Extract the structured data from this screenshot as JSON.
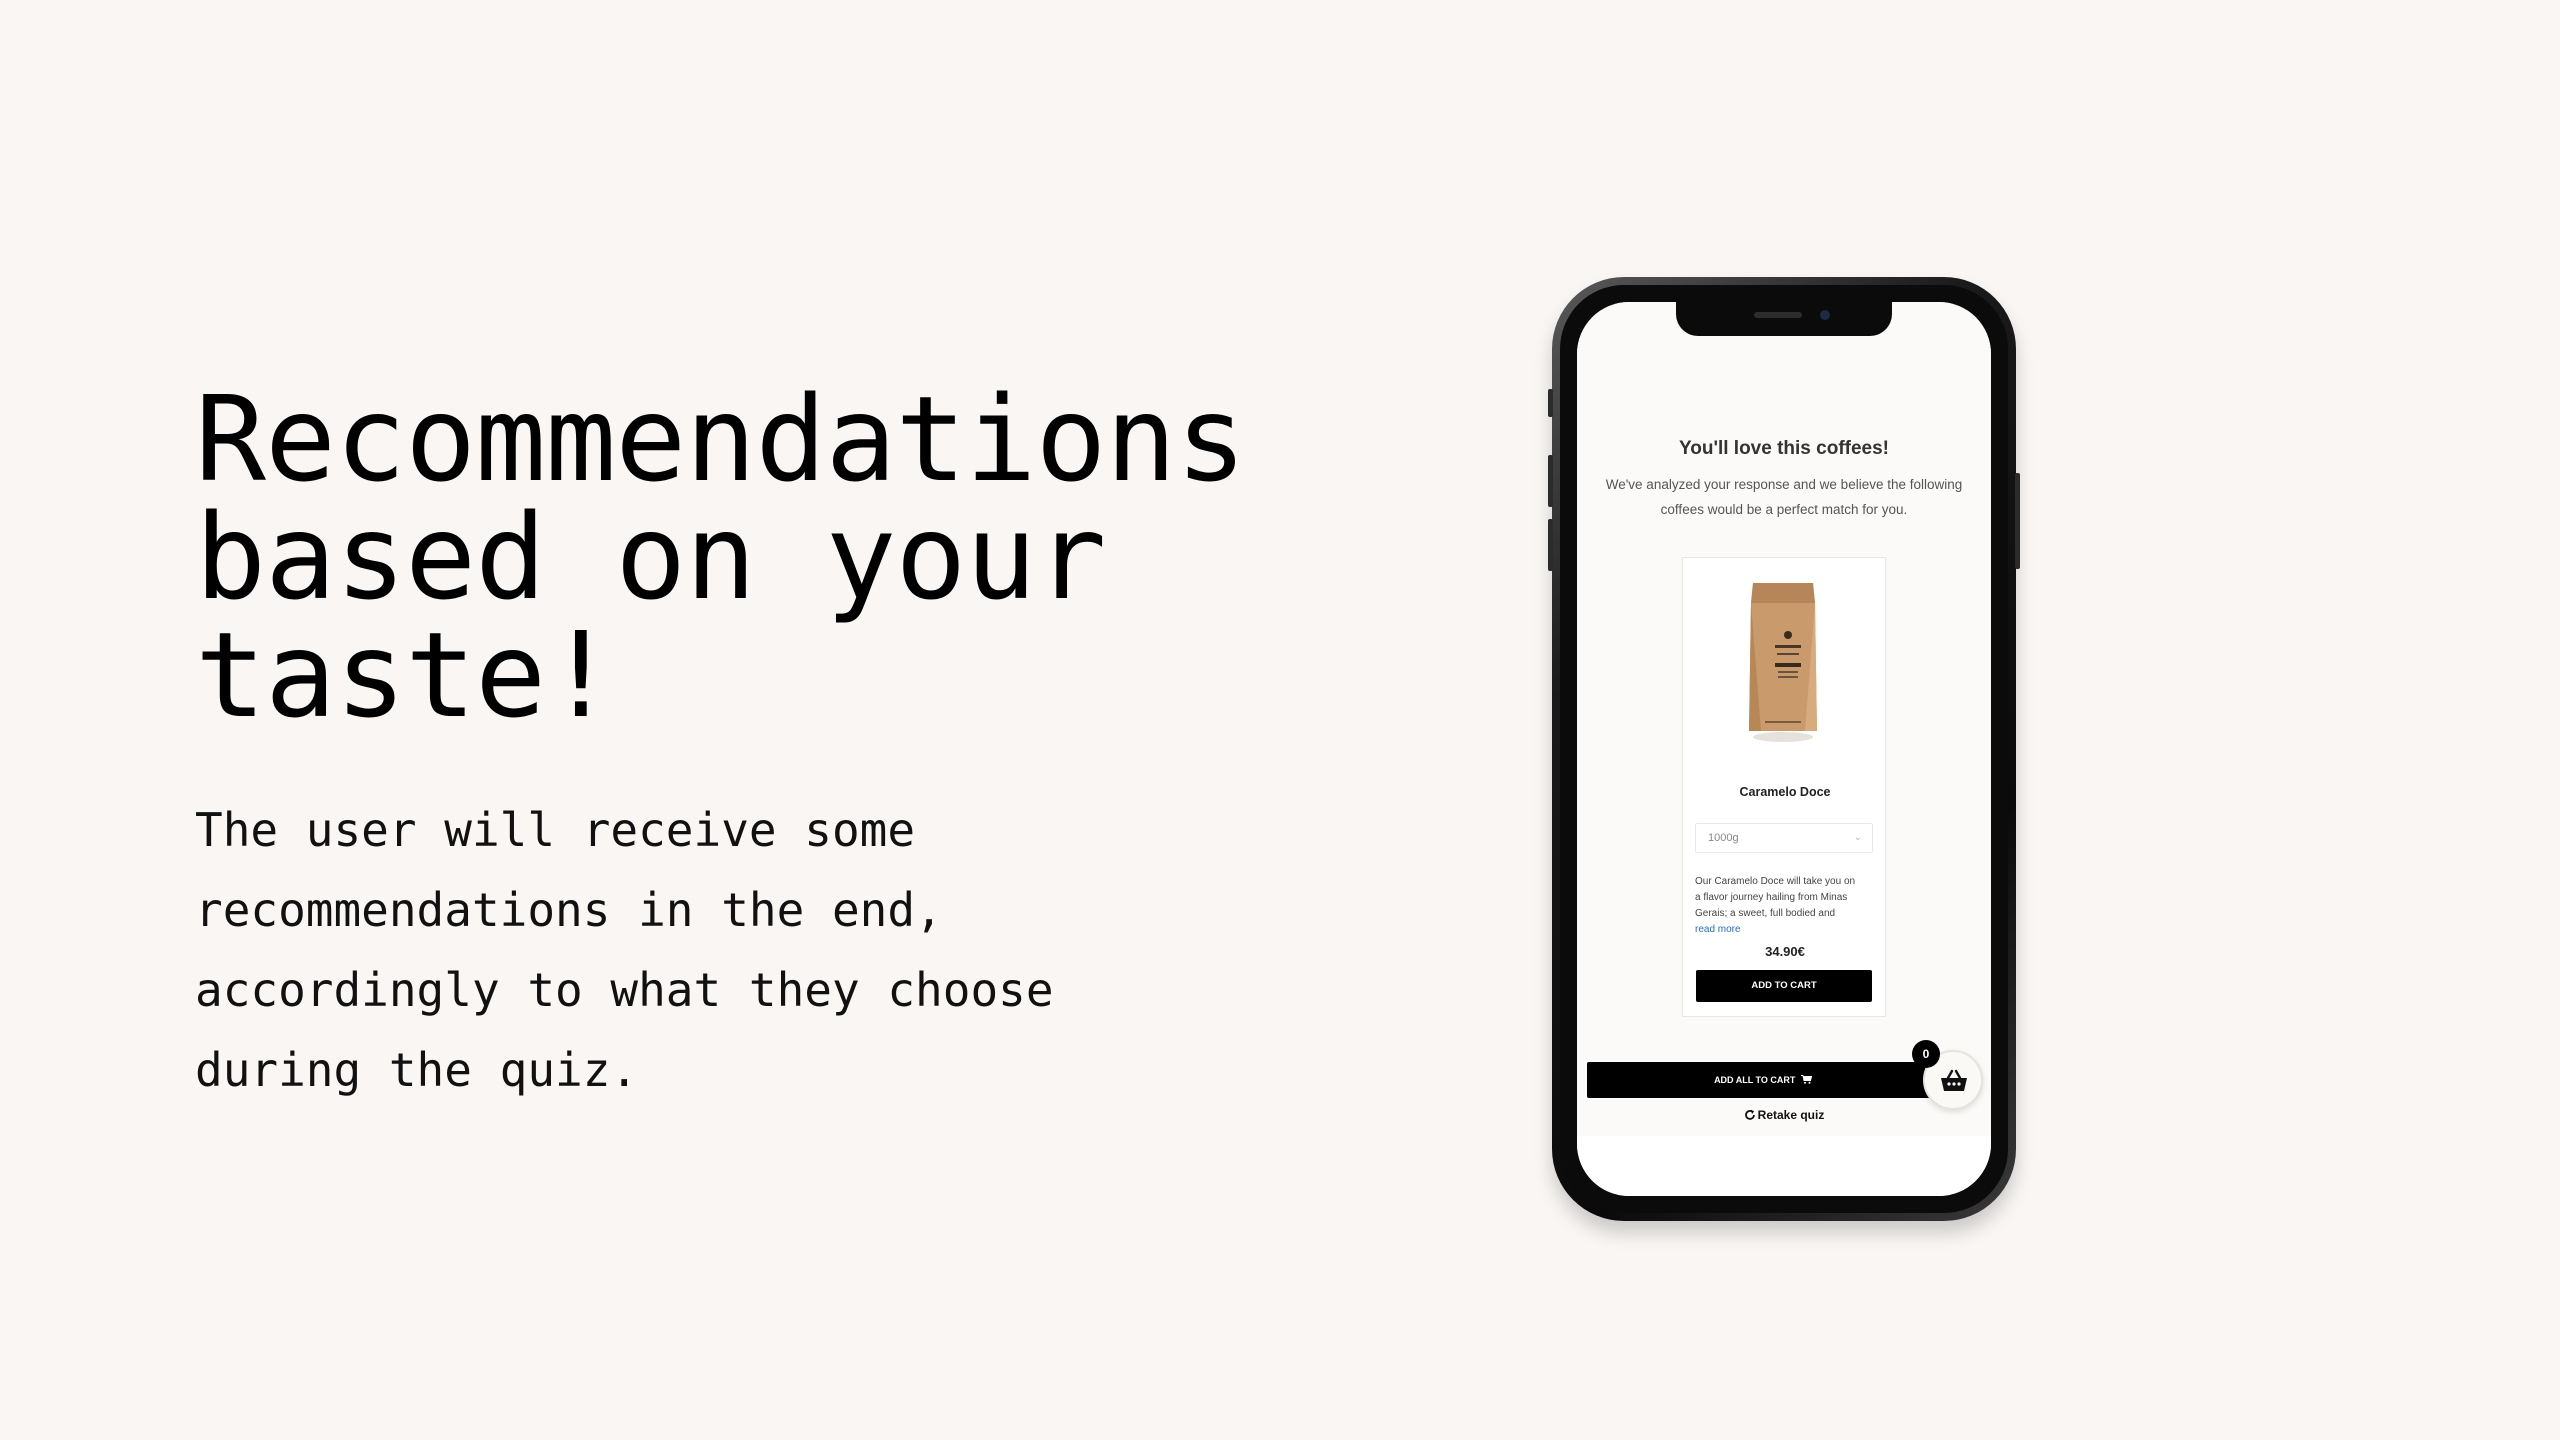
{
  "slide": {
    "headline_lines": [
      "Recommendations",
      "based on your",
      "taste!"
    ],
    "subtext_lines": [
      "The user will receive some",
      "recommendations in the end,",
      "accordingly to what they choose",
      "during the quiz."
    ]
  },
  "phone_screen": {
    "title": "You'll love this coffees!",
    "description_lines": [
      "We've analyzed your response and we believe the following",
      "coffees would be a perfect match for you."
    ],
    "product": {
      "name": "Caramelo Doce",
      "size_selected": "1000g",
      "description_lines": [
        "Our Caramelo Doce will take you on",
        "a flavor journey hailing from Minas",
        "Gerais; a sweet, full bodied and"
      ],
      "read_more": "read more",
      "price": "34.90€",
      "add_to_cart": "ADD TO CART"
    },
    "add_all_to_cart": "ADD ALL TO CART",
    "retake_quiz": "Retake quiz",
    "cart_count": "0"
  },
  "colors": {
    "background": "#f9f6f3",
    "text": "#000000",
    "button": "#000000",
    "link": "#2a6dc4"
  },
  "icons": [
    "cart-icon",
    "basket-icon",
    "refresh-icon",
    "chevron-down-icon"
  ]
}
